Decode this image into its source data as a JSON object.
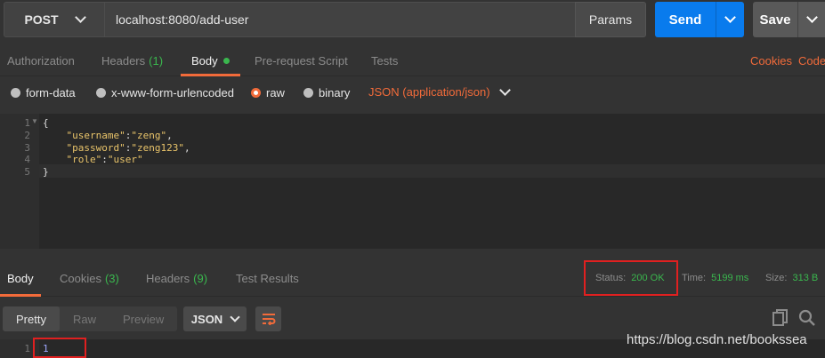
{
  "request": {
    "method": "POST",
    "url": "localhost:8080/add-user",
    "params_label": "Params",
    "send_label": "Send",
    "save_label": "Save"
  },
  "request_tabs": {
    "authorization": "Authorization",
    "headers": "Headers",
    "headers_count": "(1)",
    "body": "Body",
    "pre_request": "Pre-request Script",
    "tests": "Tests",
    "cookies": "Cookies",
    "code": "Code"
  },
  "body_types": {
    "form_data": "form-data",
    "urlencoded": "x-www-form-urlencoded",
    "raw": "raw",
    "binary": "binary",
    "selected": "raw",
    "content_type": "JSON (application/json)"
  },
  "editor": {
    "line_numbers": [
      "1",
      "2",
      "3",
      "4",
      "5"
    ],
    "open_brace": "{",
    "close_brace": "}",
    "line2_key": "\"username\"",
    "line2_val": "\"zeng\"",
    "line3_key": "\"password\"",
    "line3_val": "\"zeng123\"",
    "line4_key": "\"role\"",
    "line4_val": "\"user\""
  },
  "response_tabs": {
    "body": "Body",
    "cookies": "Cookies",
    "cookies_count": "(3)",
    "headers": "Headers",
    "headers_count": "(9)",
    "test_results": "Test Results"
  },
  "response_meta": {
    "status_label": "Status:",
    "status_value": "200 OK",
    "time_label": "Time:",
    "time_value": "5199 ms",
    "size_label": "Size:",
    "size_value": "313 B"
  },
  "response_view": {
    "pretty": "Pretty",
    "raw": "Raw",
    "preview": "Preview",
    "format": "JSON"
  },
  "response_body": {
    "line_number": "1",
    "content": "1"
  },
  "watermark": "https://blog.csdn.net/bookssea",
  "colors": {
    "accent": "#f26b3a",
    "send": "#097bed",
    "success": "#3ab74e",
    "highlight": "#e02020"
  }
}
